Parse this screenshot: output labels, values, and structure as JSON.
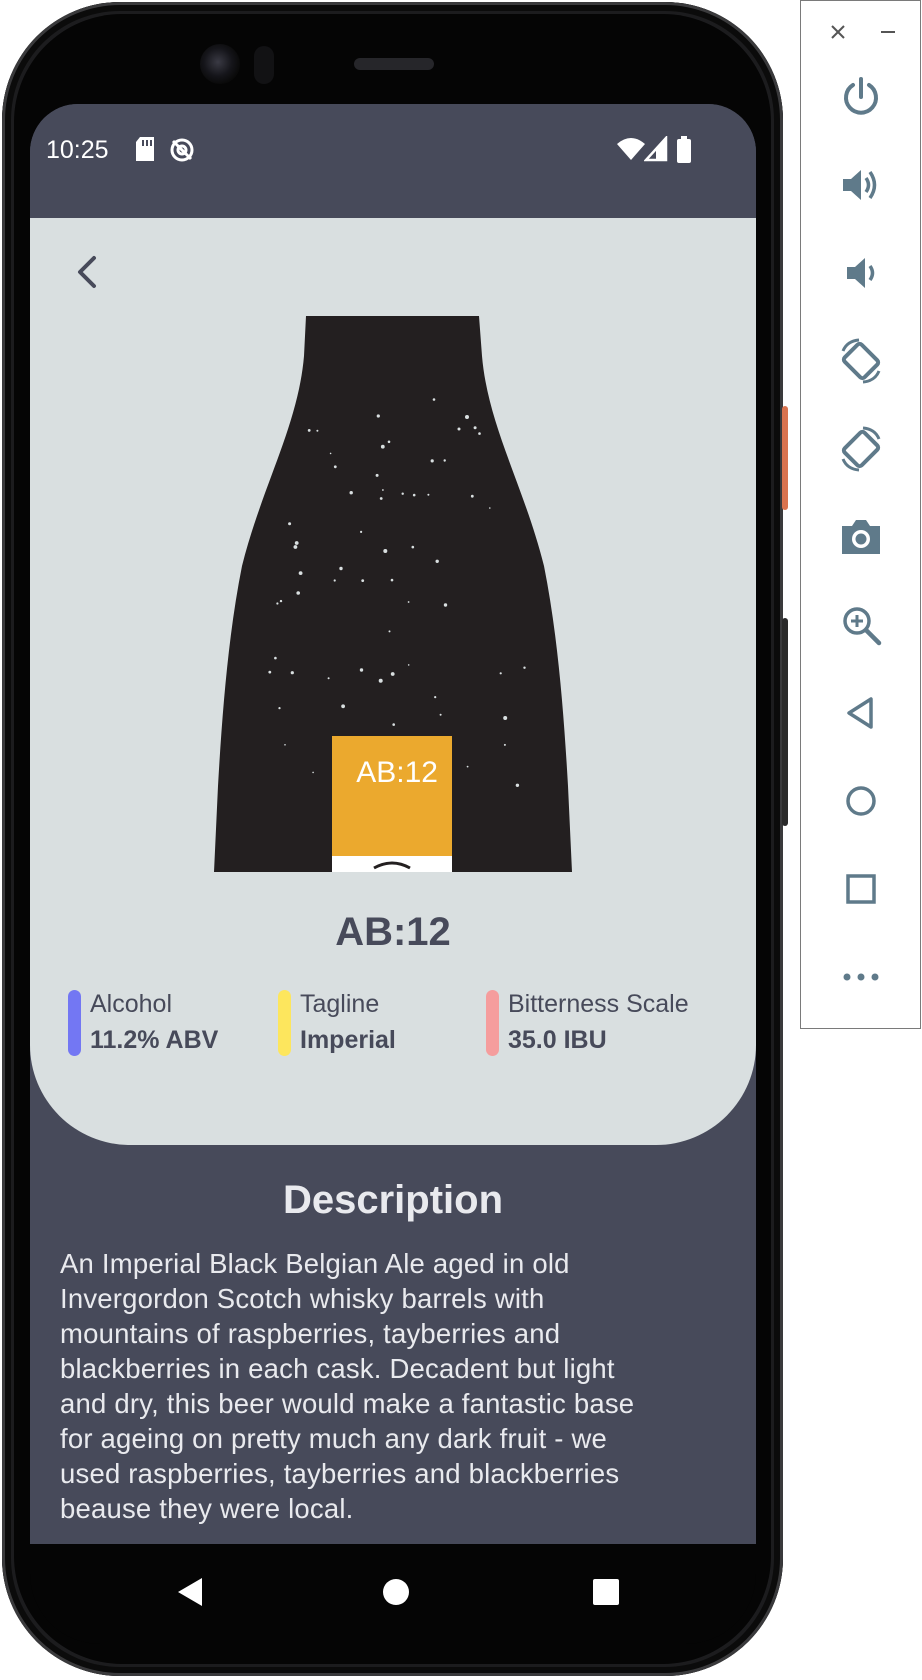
{
  "status_bar": {
    "time": "10:25",
    "icons": [
      "sd-card-icon",
      "sync-disabled-icon",
      "wifi-icon",
      "signal-icon",
      "battery-icon"
    ]
  },
  "beer": {
    "name": "AB:12",
    "label_text": "AB:12",
    "label_color": "#eba92e",
    "bottle_color": "#231f20"
  },
  "stats": [
    {
      "label": "Alcohol",
      "value": "11.2% ABV",
      "color": "#7377f3"
    },
    {
      "label": "Tagline",
      "value": "Imperial",
      "color": "#fde65d"
    },
    {
      "label": "Bitterness Scale",
      "value": "35.0 IBU",
      "color": "#f59d9d"
    }
  ],
  "description": {
    "heading": "Description",
    "lines": [
      "An Imperial Black Belgian Ale aged in old",
      "Invergordon Scotch whisky barrels with",
      "mountains of raspberries, tayberries and",
      "blackberries in each cask. Decadent but light",
      "and dry, this beer would make a fantastic base",
      "for ageing on pretty much any dark fruit - we",
      "used raspberries, tayberries and blackberries",
      "beause they were local."
    ]
  },
  "navigation": [
    "back-icon",
    "home-icon",
    "recents-icon"
  ],
  "emulator_toolbar": {
    "window_controls": [
      "close-icon",
      "minimize-icon"
    ],
    "buttons": [
      "power-icon",
      "volume-up-icon",
      "volume-down-icon",
      "rotate-left-icon",
      "rotate-right-icon",
      "camera-icon",
      "zoom-icon",
      "back-icon",
      "home-icon",
      "overview-icon",
      "more-icon"
    ]
  },
  "colors": {
    "app_background": "#474a5a",
    "card_background": "#d9dfe0",
    "text_dark": "#474a5a",
    "text_light": "#e9eaee",
    "toolbar_icon": "#5f7a8a"
  }
}
